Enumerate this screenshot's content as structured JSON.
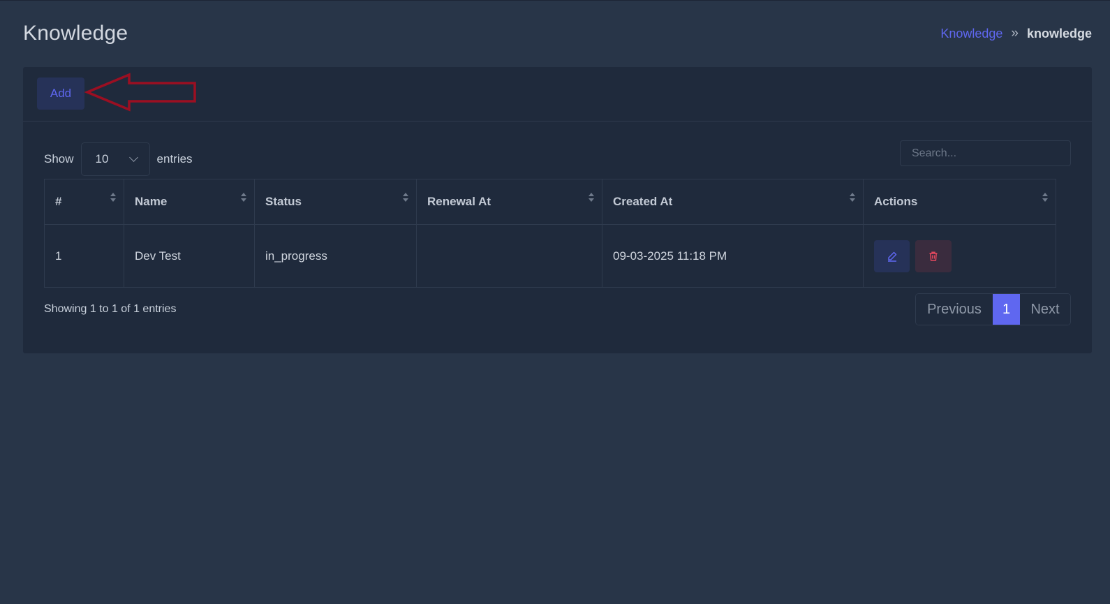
{
  "page": {
    "title": "Knowledge",
    "breadcrumb": {
      "link": "Knowledge",
      "separator": "»",
      "current": "knowledge"
    }
  },
  "toolbar": {
    "add_label": "Add"
  },
  "controls": {
    "show_label": "Show",
    "entries_value": "10",
    "entries_label": "entries",
    "search_placeholder": "Search..."
  },
  "table": {
    "columns": [
      "#",
      "Name",
      "Status",
      "Renewal At",
      "Created At",
      "Actions"
    ],
    "rows": [
      {
        "index": "1",
        "name": "Dev Test",
        "status": "in_progress",
        "renewal_at": "",
        "created_at": "09-03-2025 11:18 PM"
      }
    ]
  },
  "footer": {
    "info": "Showing 1 to 1 of 1 entries",
    "previous": "Previous",
    "current_page": "1",
    "next": "Next"
  },
  "colors": {
    "background": "#283548",
    "card": "#1f2a3c",
    "accent": "#5f67f0",
    "danger": "#e5485e",
    "annotation_arrow": "#9b0f22"
  },
  "icons": {
    "edit": "pencil-icon",
    "delete": "trash-icon",
    "annotation": "arrow-left-outline"
  }
}
